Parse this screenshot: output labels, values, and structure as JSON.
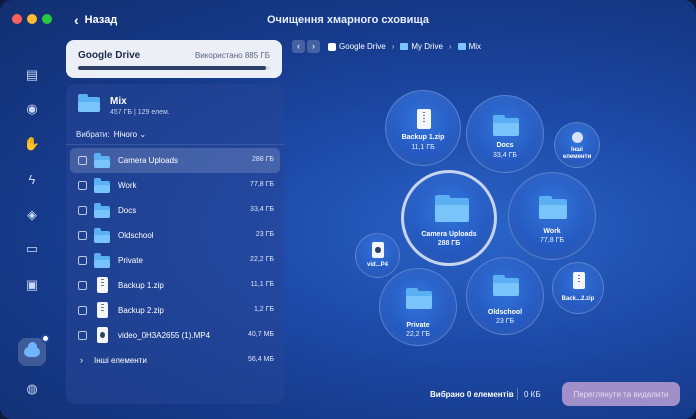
{
  "window": {
    "title": "Очищення хмарного сховища",
    "back_label": "Назад"
  },
  "drive": {
    "name": "Google Drive",
    "usage": "Використано 885 ГБ",
    "usage_fraction": 0.98
  },
  "folder": {
    "name": "Mix",
    "meta": "457 ГБ  |  129 елем."
  },
  "select": {
    "label": "Вибрати:",
    "value": "Нічого",
    "chevron": "chevron-down-icon"
  },
  "items": [
    {
      "name": "Camera Uploads",
      "size": "288 ГБ",
      "icon": "folder",
      "selected": true
    },
    {
      "name": "Work",
      "size": "77,8 ГБ",
      "icon": "folder"
    },
    {
      "name": "Docs",
      "size": "33,4 ГБ",
      "icon": "folder"
    },
    {
      "name": "Oldschool",
      "size": "23 ГБ",
      "icon": "folder"
    },
    {
      "name": "Private",
      "size": "22,2 ГБ",
      "icon": "folder"
    },
    {
      "name": "Backup 1.zip",
      "size": "11,1 ГБ",
      "icon": "zip"
    },
    {
      "name": "Backup 2.zip",
      "size": "1,2 ГБ",
      "icon": "zip"
    },
    {
      "name": "video_0H3A2655 (1).MP4",
      "size": "40,7 МБ",
      "icon": "video"
    }
  ],
  "more": {
    "name": "Інші елементи",
    "size": "56,4 МБ"
  },
  "breadcrumb": [
    "Google Drive",
    "My Drive",
    "Mix"
  ],
  "bubbles": {
    "camera": {
      "label": "Camera Uploads",
      "size": "288 ГБ"
    },
    "work": {
      "label": "Work",
      "size": "77,8 ГБ"
    },
    "docs": {
      "label": "Docs",
      "size": "33,4 ГБ"
    },
    "backup1": {
      "label": "Backup 1.zip",
      "size": "11,1 ГБ"
    },
    "other": {
      "label": "Інші елементи"
    },
    "oldschool": {
      "label": "Oldschool",
      "size": "23 ГБ"
    },
    "private": {
      "label": "Private",
      "size": "22,2 ГБ"
    },
    "backup2": {
      "label": "Back...2.zip"
    },
    "video": {
      "label": "vid...P4"
    }
  },
  "footer": {
    "selected": "Вибрано 0 елементів",
    "size": "0 КБ",
    "review_label": "Переглянути та видалити"
  },
  "colors": {
    "accent": "#5ab0f2",
    "review_button": "#a08fc9"
  }
}
